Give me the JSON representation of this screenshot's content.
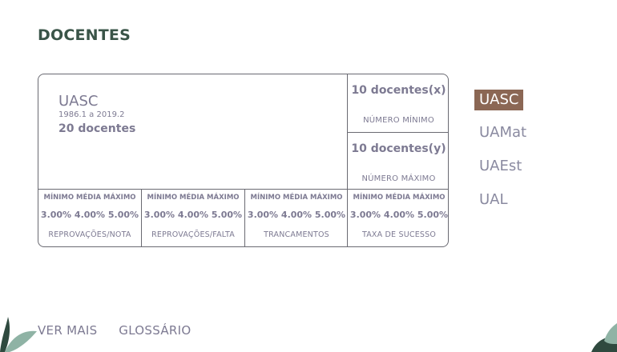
{
  "page": {
    "title": "DOCENTES"
  },
  "card": {
    "unit": "UASC",
    "period": "1986.1 a 2019.2",
    "total": "20 docentes",
    "min_box": {
      "value": "10 docentes(x)",
      "label": "NÚMERO MÍNIMO"
    },
    "max_box": {
      "value": "10 docentes(y)",
      "label": "NÚMERO MÁXIMO"
    },
    "metrics": [
      {
        "header": "MÍNIMO MÉDIA MÁXIMO",
        "values": "3.00% 4.00% 5.00%",
        "name": "REPROVAÇÕES/NOTA"
      },
      {
        "header": "MÍNIMO MÉDIA MÁXIMO",
        "values": "3.00% 4.00% 5.00%",
        "name": "REPROVAÇÕES/FALTA"
      },
      {
        "header": "MÍNIMO MÉDIA MÁXIMO",
        "values": "3.00% 4.00% 5.00%",
        "name": "TRANCAMENTOS"
      },
      {
        "header": "MÍNIMO MÉDIA MÁXIMO",
        "values": "3.00% 4.00% 5.00%",
        "name": "TAXA DE SUCESSO"
      }
    ]
  },
  "units": {
    "items": [
      "UASC",
      "UAMat",
      "UAEst",
      "UAL"
    ],
    "active": "UASC"
  },
  "footer": {
    "more": "VER MAIS",
    "glossary": "GLOSSÁRIO"
  },
  "colors": {
    "title": "#3a5448",
    "active_unit_bg": "#8b6754",
    "text": "#7d7a92",
    "border": "#6a6a72",
    "leaf_light": "#8fb3a5",
    "leaf_dark": "#2f4a3f"
  }
}
